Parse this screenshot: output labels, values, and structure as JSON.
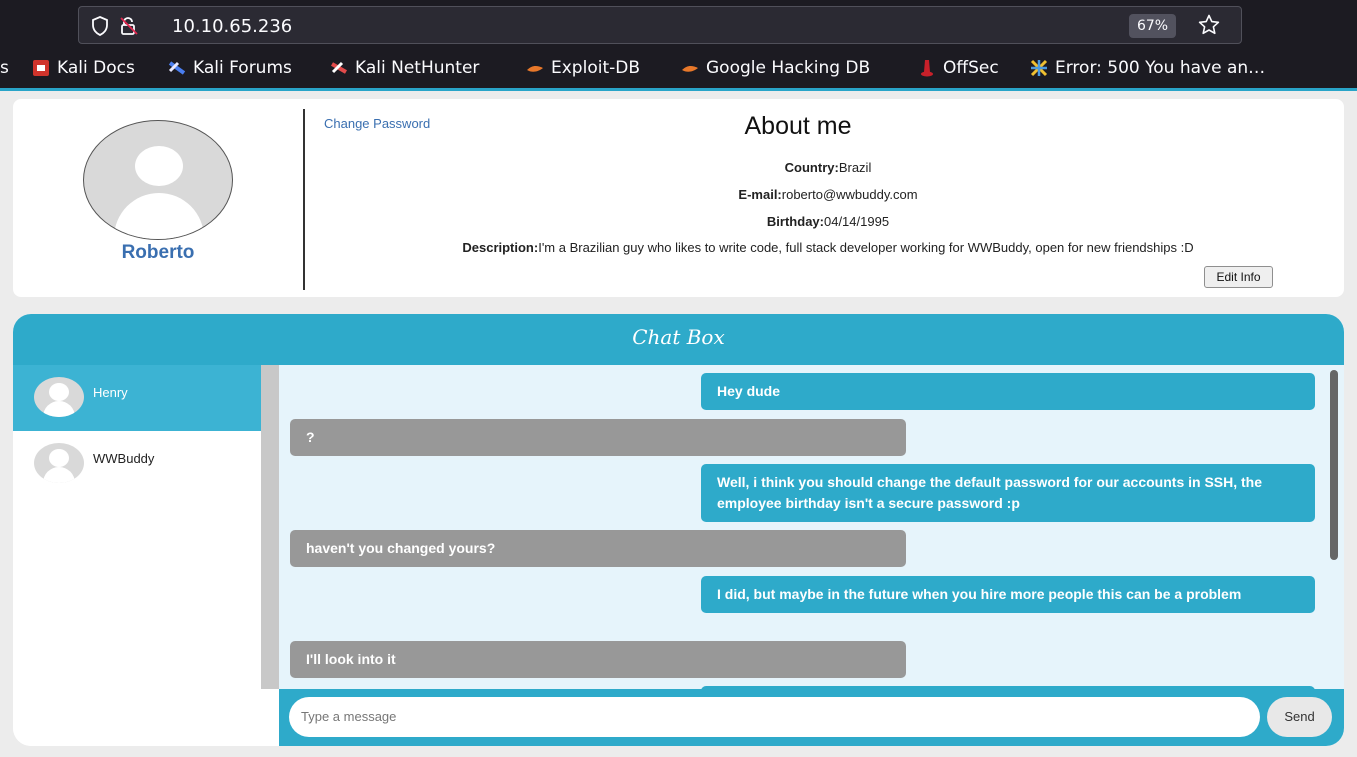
{
  "browser": {
    "url": "10.10.65.236",
    "zoom": "67%",
    "bookmarks": [
      {
        "label": "s",
        "icon": "none",
        "color": "#1c1b22"
      },
      {
        "label": "Kali Docs",
        "icon": "kali-docs-icon",
        "color": "#d0342c"
      },
      {
        "label": "Kali Forums",
        "icon": "kali-forums-icon",
        "color": "#4a7ef0"
      },
      {
        "label": "Kali NetHunter",
        "icon": "kali-nethunter-icon",
        "color": "#e24b4b"
      },
      {
        "label": "Exploit-DB",
        "icon": "exploit-db-icon",
        "color": "#e8782a"
      },
      {
        "label": "Google Hacking DB",
        "icon": "ghdb-icon",
        "color": "#e8782a"
      },
      {
        "label": "OffSec",
        "icon": "offsec-icon",
        "color": "#c8202a"
      },
      {
        "label": "Error: 500 You have an…",
        "icon": "error-page-icon",
        "color": "#f0c030"
      }
    ]
  },
  "profile": {
    "name": "Roberto",
    "change_password": "Change Password",
    "about_title": "About me",
    "country_label": "Country:",
    "country": "Brazil",
    "email_label": "E-mail:",
    "email": "roberto@wwbuddy.com",
    "birthday_label": "Birthday:",
    "birthday": "04/14/1995",
    "description_label": "Description:",
    "description": "I'm a Brazilian guy who likes to write code, full stack developer working for WWBuddy, open for new friendships :D",
    "edit_info": "Edit Info"
  },
  "chat": {
    "title": "Chat Box",
    "contacts": [
      {
        "name": "Henry",
        "active": true
      },
      {
        "name": "WWBuddy",
        "active": false
      }
    ],
    "messages": [
      {
        "from": "me",
        "text": "Hey dude"
      },
      {
        "from": "them",
        "text": "?"
      },
      {
        "from": "me",
        "text": "Well, i think you should change the default password for our accounts in SSH, the employee birthday isn't a secure password :p"
      },
      {
        "from": "them",
        "text": "haven't you changed yours?"
      },
      {
        "from": "me",
        "text": "I did, but maybe in the future when you hire more people this can be a problem"
      },
      {
        "from": "them",
        "text": "I'll look into it"
      },
      {
        "from": "me",
        "text": ""
      }
    ],
    "input_placeholder": "Type a message",
    "send_label": "Send"
  }
}
